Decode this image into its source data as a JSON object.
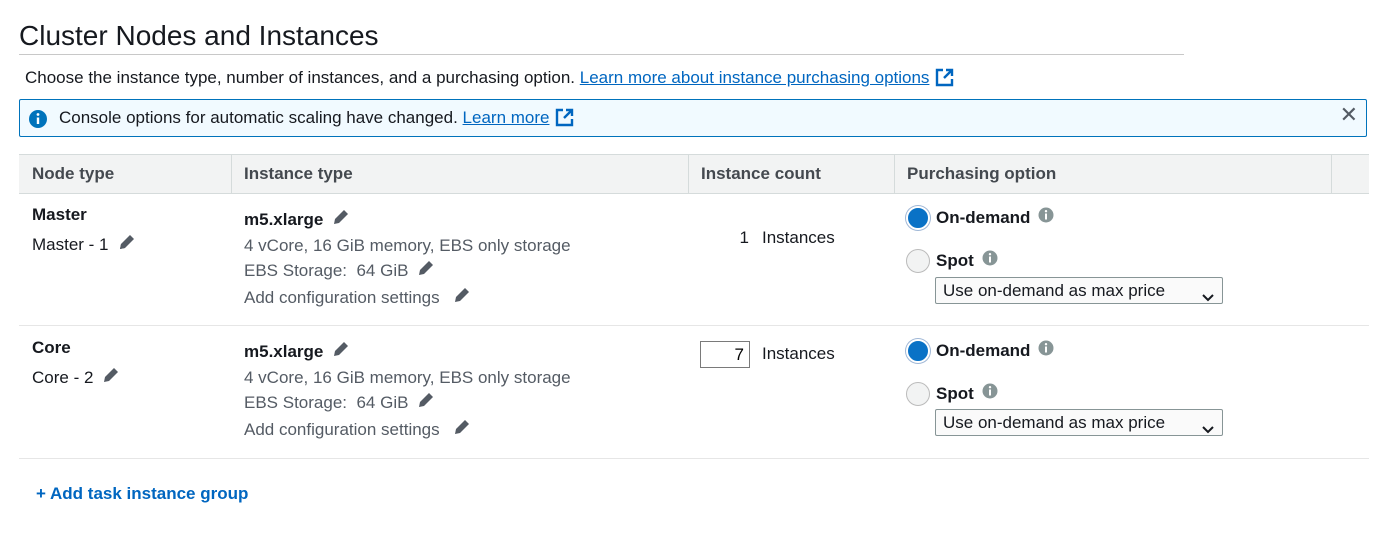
{
  "section_title": "Cluster Nodes and Instances",
  "intro": {
    "text": "Choose the instance type, number of instances, and a purchasing option.",
    "link": "Learn more about instance purchasing options"
  },
  "alert": {
    "message": "Console options for automatic scaling have changed.",
    "link": "Learn more",
    "close_glyph": "✕"
  },
  "table": {
    "headers": {
      "node_type": "Node type",
      "instance_type": "Instance type",
      "instance_count": "Instance count",
      "purchasing_option": "Purchasing option"
    },
    "rows": [
      {
        "node_name": "Master",
        "node_sub": "Master - 1",
        "instance_type": "m5.xlarge",
        "spec": "4 vCore, 16 GiB memory, EBS only storage",
        "ebs_label": "EBS Storage:",
        "ebs_value": "64 GiB",
        "config_label": "Add configuration settings",
        "count": "1",
        "count_editable": false,
        "count_unit": "Instances",
        "option_ondemand": "On-demand",
        "option_spot": "Spot",
        "selected_option": "On-demand",
        "max_price_select": "Use on-demand as max price"
      },
      {
        "node_name": "Core",
        "node_sub": "Core - 2",
        "instance_type": "m5.xlarge",
        "spec": "4 vCore, 16 GiB memory, EBS only storage",
        "ebs_label": "EBS Storage:",
        "ebs_value": "64 GiB",
        "config_label": "Add configuration settings",
        "count": "7",
        "count_editable": true,
        "count_unit": "Instances",
        "option_ondemand": "On-demand",
        "option_spot": "Spot",
        "selected_option": "On-demand",
        "max_price_select": "Use on-demand as max price"
      }
    ]
  },
  "add_task_group": "+ Add task instance group",
  "colors": {
    "link": "#0066c0",
    "alert_border": "#0073bb",
    "alert_bg": "#f1faff",
    "radio_selected": "#0a72c6",
    "header_bg": "#f2f3f3"
  },
  "icons": [
    "info-icon",
    "external-link-icon",
    "close-icon",
    "pencil-icon",
    "chevron-down-icon"
  ]
}
